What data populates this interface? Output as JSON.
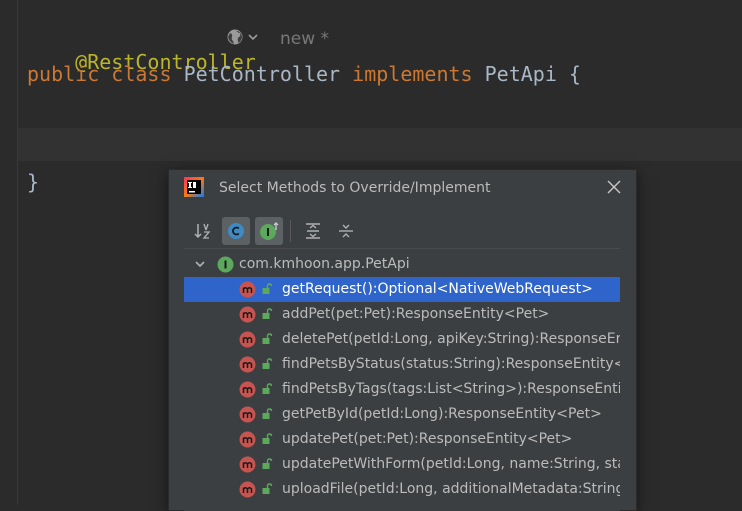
{
  "editor": {
    "annotation": "@RestController",
    "new_hint": "new *",
    "line2": {
      "kw_public": "public",
      "kw_class": "class",
      "class_name": "PetController",
      "kw_implements": "implements",
      "interface": "PetApi",
      "brace_open": "{"
    },
    "brace_close": "}"
  },
  "dialog": {
    "title": "Select Methods to Override/Implement",
    "tree_root": "com.kmhoon.app.PetApi",
    "methods": [
      {
        "label": "getRequest():Optional<NativeWebRequest>",
        "selected": true
      },
      {
        "label": "addPet(pet:Pet):ResponseEntity<Pet>",
        "selected": false
      },
      {
        "label": "deletePet(petId:Long, apiKey:String):ResponseEntity<Void>",
        "selected": false
      },
      {
        "label": "findPetsByStatus(status:String):ResponseEntity<List<Pet>>",
        "selected": false
      },
      {
        "label": "findPetsByTags(tags:List<String>):ResponseEntity<List<Pet>>",
        "selected": false
      },
      {
        "label": "getPetById(petId:Long):ResponseEntity<Pet>",
        "selected": false
      },
      {
        "label": "updatePet(pet:Pet):ResponseEntity<Pet>",
        "selected": false
      },
      {
        "label": "updatePetWithForm(petId:Long, name:String, status:String)",
        "selected": false
      },
      {
        "label": "uploadFile(petId:Long, additionalMetadata:String, file:MultipartFile)",
        "selected": false
      }
    ],
    "toolbar": [
      "sort-alpha-icon",
      "show-classes-icon",
      "show-interfaces-icon",
      "expand-all-icon",
      "collapse-all-icon"
    ]
  },
  "colors": {
    "keyword": "#cc7832",
    "annotation": "#bbb529",
    "identifier": "#a9b7c6",
    "selection": "#2f65ca",
    "method_badge": "#c75450",
    "interface_badge": "#5ca85c"
  }
}
